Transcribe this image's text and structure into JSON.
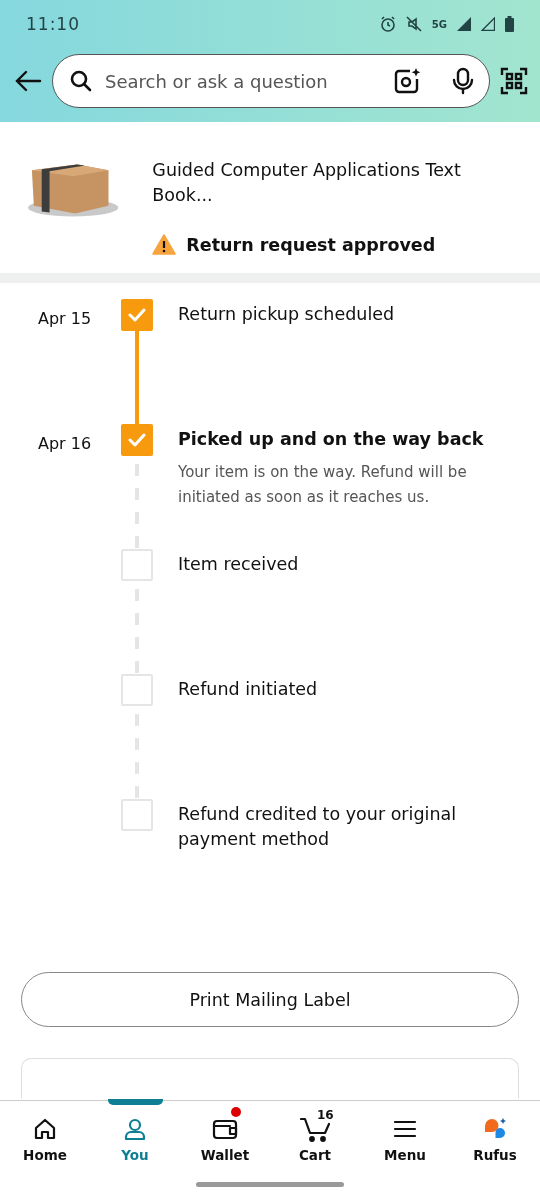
{
  "status_bar": {
    "time": "11:10",
    "network": "5G"
  },
  "search": {
    "placeholder": "Search or ask a question"
  },
  "product": {
    "title": "Guided Computer Applications Text Book...",
    "status": "Return request approved"
  },
  "timeline": [
    {
      "date": "Apr 15",
      "title": "Return pickup scheduled",
      "checked": true,
      "current": false
    },
    {
      "date": "Apr 16",
      "title": "Picked up and on the way back",
      "description": "Your item is on the way. Refund will be initiated as soon as it reaches us.",
      "checked": true,
      "current": true
    },
    {
      "title": "Item received",
      "checked": false,
      "current": false
    },
    {
      "title": "Refund initiated",
      "checked": false,
      "current": false
    },
    {
      "title": "Refund credited to your original payment method",
      "checked": false,
      "current": false
    }
  ],
  "print_button": "Print Mailing Label",
  "nav": [
    {
      "kind": "home",
      "label": "Home",
      "selected": false,
      "dot": false
    },
    {
      "kind": "you",
      "label": "You",
      "selected": true,
      "dot": false
    },
    {
      "kind": "wallet",
      "label": "Wallet",
      "selected": false,
      "dot": true
    },
    {
      "kind": "cart",
      "label": "Cart",
      "selected": false,
      "dot": false,
      "badge": "16"
    },
    {
      "kind": "menu",
      "label": "Menu",
      "selected": false,
      "dot": false
    },
    {
      "kind": "rufus",
      "label": "Rufus",
      "selected": false,
      "dot": false
    }
  ]
}
